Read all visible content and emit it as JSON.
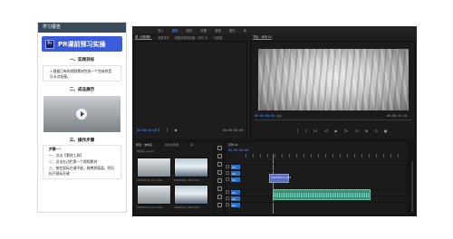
{
  "study": {
    "title": "学习报告",
    "banner_logo": "Pr",
    "banner_text": "PR课前预习实操",
    "section1_title": "一、实践目标",
    "section1_body": "1.根据已有的视频素材完成一个完成的音乐卡点短视。",
    "section2_title": "二、成品展示",
    "section3_title": "三、操作步骤",
    "steps_heading": "步骤一：",
    "step1": "一、点击【素材工具】",
    "step2": "二、点击左边栏第一个视频素材",
    "step3": "三、按住鼠标左键不放，拖拽到画面，然后松开鼠标左键"
  },
  "premiere": {
    "menu": [
      "导入",
      "编辑",
      "颜色",
      "效果",
      "音频",
      "图形",
      "库"
    ],
    "active_menu": "编辑",
    "source_tabs": [
      "源（无剪辑）",
      "效果控件",
      "音频剪辑混合器：序列 01",
      "元数据"
    ],
    "source_timecodes": [
      "00:00:00:00",
      "00:00:00:00"
    ],
    "program_tab": "节目：序列 01",
    "program_timecode": "00:00:00:00",
    "program_fit": "适合",
    "program_end": "00:00:15:10",
    "program_controls": [
      "{",
      "}",
      "|<",
      "<|",
      "▶",
      "|>",
      ">|",
      "⊞",
      "⊡",
      "▣"
    ],
    "project_tabs": [
      "项目：未命名",
      "媒体浏览器",
      "库"
    ],
    "project_name": "未命名.prproj",
    "project_clips": [
      "20180101_001.mp4",
      "20180101_002.mp4",
      "20180101_003.mp4",
      "20180101_004.mp4"
    ],
    "timeline_tab": "序列 01",
    "timeline_timecode": "00:00:00:00",
    "tracks": [
      "V3",
      "V2",
      "V1",
      "A1",
      "A2",
      "A3"
    ],
    "video_clip_label": "20180101_001"
  }
}
